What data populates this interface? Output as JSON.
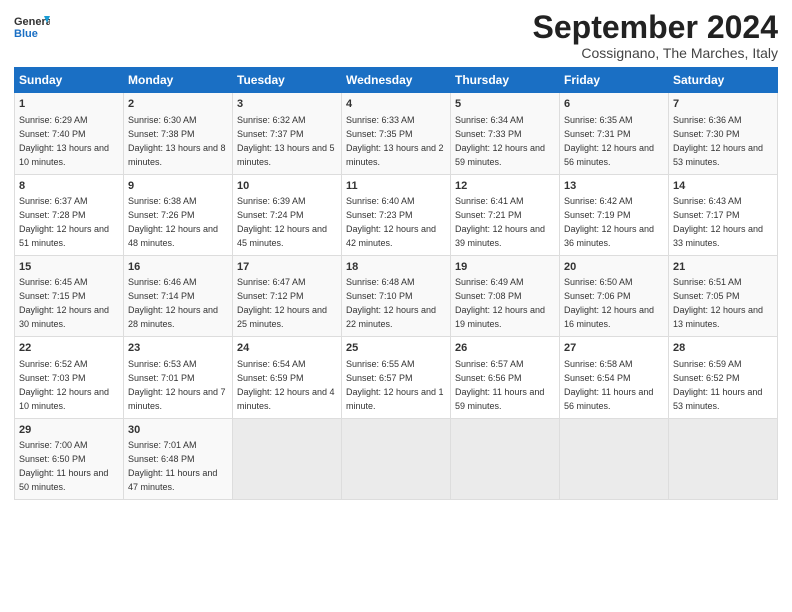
{
  "header": {
    "title": "September 2024",
    "subtitle": "Cossignano, The Marches, Italy",
    "logo_line1": "General",
    "logo_line2": "Blue"
  },
  "calendar": {
    "headers": [
      "Sunday",
      "Monday",
      "Tuesday",
      "Wednesday",
      "Thursday",
      "Friday",
      "Saturday"
    ],
    "rows": [
      [
        {
          "day": "",
          "empty": true
        },
        {
          "day": "2",
          "rise": "6:30 AM",
          "set": "7:38 PM",
          "daylight": "13 hours and 8 minutes."
        },
        {
          "day": "3",
          "rise": "6:32 AM",
          "set": "7:37 PM",
          "daylight": "13 hours and 5 minutes."
        },
        {
          "day": "4",
          "rise": "6:33 AM",
          "set": "7:35 PM",
          "daylight": "13 hours and 2 minutes."
        },
        {
          "day": "5",
          "rise": "6:34 AM",
          "set": "7:33 PM",
          "daylight": "12 hours and 59 minutes."
        },
        {
          "day": "6",
          "rise": "6:35 AM",
          "set": "7:31 PM",
          "daylight": "12 hours and 56 minutes."
        },
        {
          "day": "7",
          "rise": "6:36 AM",
          "set": "7:30 PM",
          "daylight": "12 hours and 53 minutes."
        }
      ],
      [
        {
          "day": "1",
          "rise": "6:29 AM",
          "set": "7:40 PM",
          "daylight": "13 hours and 10 minutes."
        },
        {
          "day": "",
          "empty": true
        },
        {
          "day": "",
          "empty": true
        },
        {
          "day": "",
          "empty": true
        },
        {
          "day": "",
          "empty": true
        },
        {
          "day": "",
          "empty": true
        },
        {
          "day": "",
          "empty": true
        }
      ],
      [
        {
          "day": "8",
          "rise": "6:37 AM",
          "set": "7:28 PM",
          "daylight": "12 hours and 51 minutes."
        },
        {
          "day": "9",
          "rise": "6:38 AM",
          "set": "7:26 PM",
          "daylight": "12 hours and 48 minutes."
        },
        {
          "day": "10",
          "rise": "6:39 AM",
          "set": "7:24 PM",
          "daylight": "12 hours and 45 minutes."
        },
        {
          "day": "11",
          "rise": "6:40 AM",
          "set": "7:23 PM",
          "daylight": "12 hours and 42 minutes."
        },
        {
          "day": "12",
          "rise": "6:41 AM",
          "set": "7:21 PM",
          "daylight": "12 hours and 39 minutes."
        },
        {
          "day": "13",
          "rise": "6:42 AM",
          "set": "7:19 PM",
          "daylight": "12 hours and 36 minutes."
        },
        {
          "day": "14",
          "rise": "6:43 AM",
          "set": "7:17 PM",
          "daylight": "12 hours and 33 minutes."
        }
      ],
      [
        {
          "day": "15",
          "rise": "6:45 AM",
          "set": "7:15 PM",
          "daylight": "12 hours and 30 minutes."
        },
        {
          "day": "16",
          "rise": "6:46 AM",
          "set": "7:14 PM",
          "daylight": "12 hours and 28 minutes."
        },
        {
          "day": "17",
          "rise": "6:47 AM",
          "set": "7:12 PM",
          "daylight": "12 hours and 25 minutes."
        },
        {
          "day": "18",
          "rise": "6:48 AM",
          "set": "7:10 PM",
          "daylight": "12 hours and 22 minutes."
        },
        {
          "day": "19",
          "rise": "6:49 AM",
          "set": "7:08 PM",
          "daylight": "12 hours and 19 minutes."
        },
        {
          "day": "20",
          "rise": "6:50 AM",
          "set": "7:06 PM",
          "daylight": "12 hours and 16 minutes."
        },
        {
          "day": "21",
          "rise": "6:51 AM",
          "set": "7:05 PM",
          "daylight": "12 hours and 13 minutes."
        }
      ],
      [
        {
          "day": "22",
          "rise": "6:52 AM",
          "set": "7:03 PM",
          "daylight": "12 hours and 10 minutes."
        },
        {
          "day": "23",
          "rise": "6:53 AM",
          "set": "7:01 PM",
          "daylight": "12 hours and 7 minutes."
        },
        {
          "day": "24",
          "rise": "6:54 AM",
          "set": "6:59 PM",
          "daylight": "12 hours and 4 minutes."
        },
        {
          "day": "25",
          "rise": "6:55 AM",
          "set": "6:57 PM",
          "daylight": "12 hours and 1 minute."
        },
        {
          "day": "26",
          "rise": "6:57 AM",
          "set": "6:56 PM",
          "daylight": "11 hours and 59 minutes."
        },
        {
          "day": "27",
          "rise": "6:58 AM",
          "set": "6:54 PM",
          "daylight": "11 hours and 56 minutes."
        },
        {
          "day": "28",
          "rise": "6:59 AM",
          "set": "6:52 PM",
          "daylight": "11 hours and 53 minutes."
        }
      ],
      [
        {
          "day": "29",
          "rise": "7:00 AM",
          "set": "6:50 PM",
          "daylight": "11 hours and 50 minutes."
        },
        {
          "day": "30",
          "rise": "7:01 AM",
          "set": "6:48 PM",
          "daylight": "11 hours and 47 minutes."
        },
        {
          "day": "",
          "empty": true
        },
        {
          "day": "",
          "empty": true
        },
        {
          "day": "",
          "empty": true
        },
        {
          "day": "",
          "empty": true
        },
        {
          "day": "",
          "empty": true
        }
      ]
    ]
  }
}
